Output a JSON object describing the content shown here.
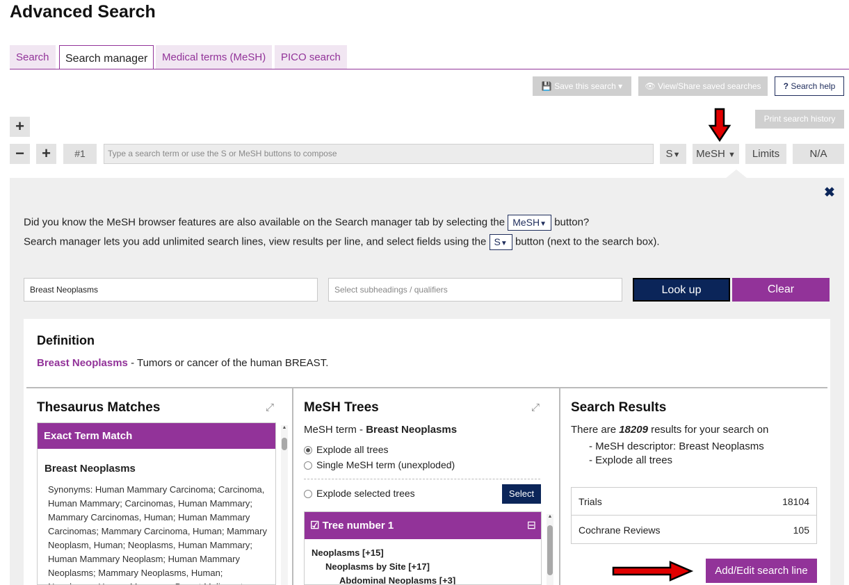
{
  "page": {
    "title": "Advanced Search"
  },
  "tabs": [
    {
      "label": "Search",
      "active": false
    },
    {
      "label": "Search manager",
      "active": true
    },
    {
      "label": "Medical terms (MeSH)",
      "active": false
    },
    {
      "label": "PICO search",
      "active": false
    }
  ],
  "toolbar": {
    "save_label": "Save this search",
    "view_share_label": "View/Share saved searches",
    "help_label": "Search help",
    "print_label": "Print search history"
  },
  "search_line": {
    "number": "#1",
    "placeholder": "Type a search term or use the S or MeSH buttons to compose",
    "s_label": "S",
    "mesh_label": "MeSH",
    "limits_label": "Limits",
    "na_label": "N/A"
  },
  "mesh_panel": {
    "info_line1_pre": "Did you know the MeSH browser features are also available on the Search manager tab by selecting the",
    "info_line1_btn": "MeSH",
    "info_line1_post": "button?",
    "info_line2_pre": "Search manager lets you add unlimited search lines, view results per line, and select fields using the",
    "info_line2_btn": "S",
    "info_line2_post": "button (next to the search box).",
    "term_value": "Breast Neoplasms",
    "subheading_placeholder": "Select subheadings / qualifiers",
    "lookup_label": "Look up",
    "clear_label": "Clear"
  },
  "definition": {
    "heading": "Definition",
    "term": "Breast Neoplasms",
    "text": " - Tumors or cancer of the human BREAST."
  },
  "thesaurus": {
    "heading": "Thesaurus Matches",
    "exact_label": "Exact Term Match",
    "term": "Breast Neoplasms",
    "synonyms": "Synonyms: Human Mammary Carcinoma; Carcinoma, Human Mammary; Carcinomas, Human Mammary; Mammary Carcinomas, Human; Human Mammary Carcinomas; Mammary Carcinoma, Human; Mammary Neoplasm, Human; Neoplasms, Human Mammary; Human Mammary Neoplasm; Human Mammary Neoplasms; Mammary Neoplasms, Human; Neoplasms, Human Mammary; Breast Malignant"
  },
  "mesh_trees": {
    "heading": "MeSH Trees",
    "term_prefix": "MeSH term - ",
    "term": "Breast Neoplasms",
    "options": [
      {
        "label": "Explode all trees",
        "checked": true
      },
      {
        "label": "Single MeSH term (unexploded)",
        "checked": false
      },
      {
        "label": "Explode selected trees",
        "checked": false
      }
    ],
    "select_label": "Select",
    "tree_label": "Tree number 1",
    "tree_items": [
      {
        "label": "Neoplasms [+15]",
        "level": 0
      },
      {
        "label": "Neoplasms by Site [+17]",
        "level": 1
      },
      {
        "label": "Abdominal Neoplasms [+3]",
        "level": 2
      }
    ]
  },
  "results": {
    "heading": "Search Results",
    "summary_pre": "There are ",
    "count": "18209",
    "summary_post": " results for your search on",
    "criteria": [
      "- MeSH descriptor: Breast Neoplasms",
      "- Explode all trees"
    ],
    "rows": [
      {
        "label": "Trials",
        "value": "18104"
      },
      {
        "label": "Cochrane Reviews",
        "value": "105"
      }
    ],
    "add_label": "Add/Edit search line"
  },
  "colors": {
    "brand_purple": "#923399",
    "navy": "#0b2559",
    "annotation_red": "#e10000"
  }
}
